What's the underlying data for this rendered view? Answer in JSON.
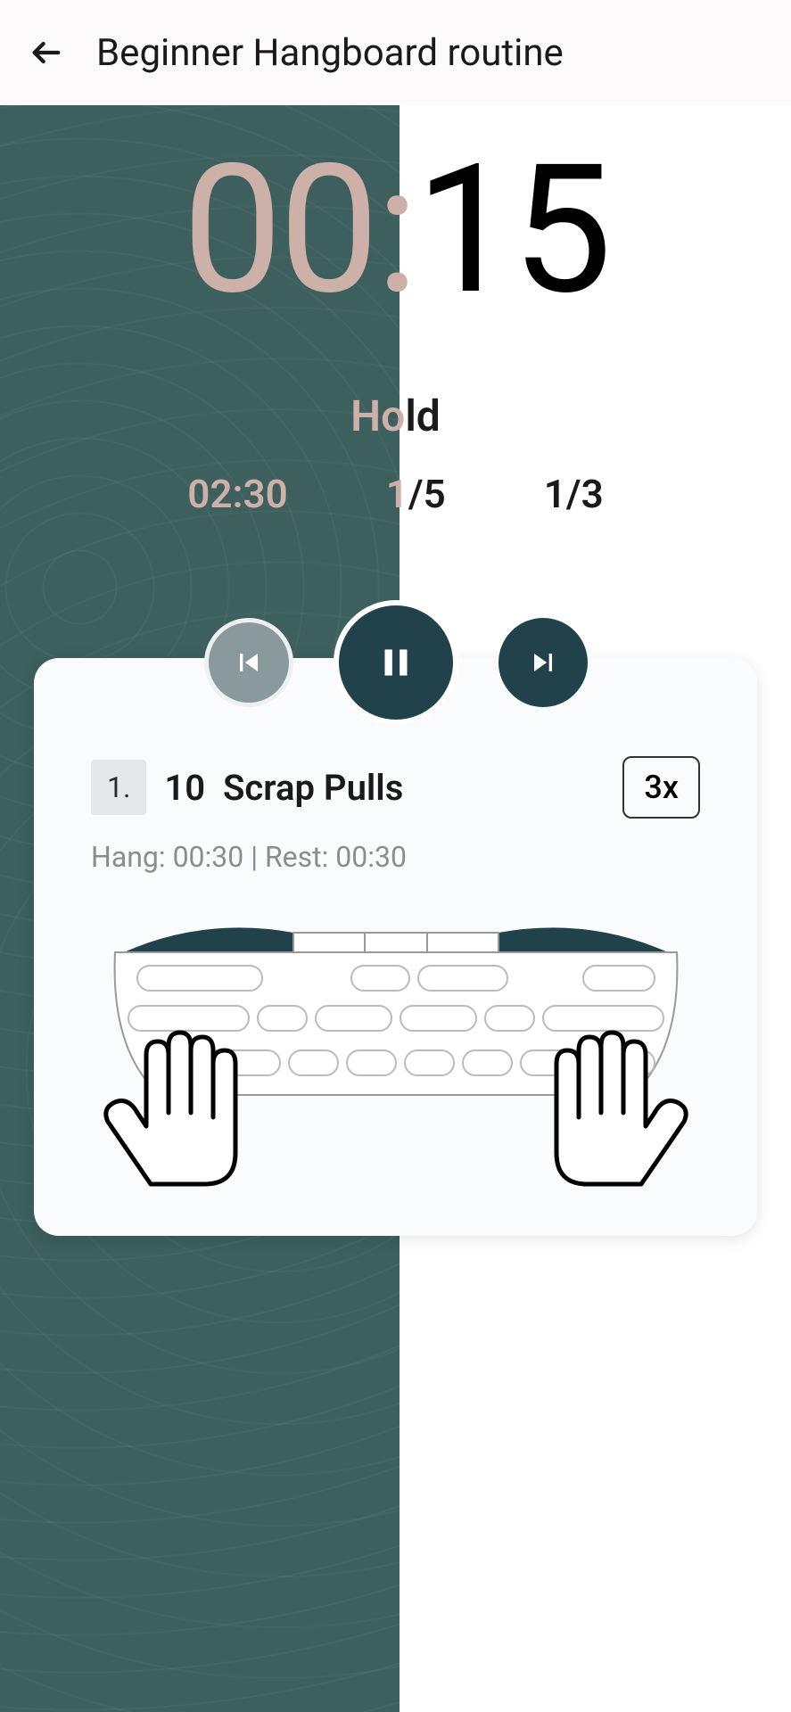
{
  "header": {
    "title": "Beginner Hangboard routine"
  },
  "timer": {
    "minutes": "00",
    "seconds": "15",
    "phase": "Hold"
  },
  "stats": {
    "elapsed": "02:30",
    "rep_cur": "1",
    "rep_total": "5",
    "set_cur": "1",
    "set_total": "3"
  },
  "exercise": {
    "index": "1.",
    "count": "10",
    "name": "Scrap Pulls",
    "reps_badge": "3x",
    "subline": "Hang: 00:30 | Rest: 00:30"
  },
  "icons": {
    "back": "back-arrow-icon",
    "prev": "skip-previous-icon",
    "pause": "pause-icon",
    "next": "skip-next-icon"
  },
  "colors": {
    "teal": "#3d5f5e",
    "dark": "#21414b",
    "rose": "#cdb0a8"
  }
}
